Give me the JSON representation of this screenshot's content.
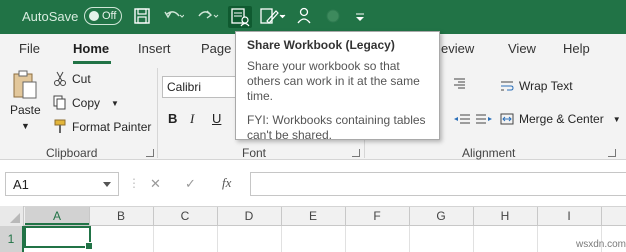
{
  "qat": {
    "autosave_label": "AutoSave",
    "autosave_state": "Off"
  },
  "tabs": [
    "File",
    "Home",
    "Insert",
    "Page",
    "eview",
    "View",
    "Help"
  ],
  "clipboard": {
    "paste": "Paste",
    "cut": "Cut",
    "copy": "Copy",
    "format_painter": "Format Painter",
    "group_label": "Clipboard"
  },
  "font": {
    "font_name": "Calibri",
    "bold": "B",
    "italic": "I",
    "group_label": "Font"
  },
  "alignment": {
    "wrap_text": "Wrap Text",
    "merge_center": "Merge & Center",
    "group_label": "Alignment"
  },
  "formula_bar": {
    "name_box": "A1",
    "cancel_symbol": "✕",
    "enter_symbol": "✓",
    "fx_symbol": "fx"
  },
  "grid": {
    "columns": [
      "A",
      "B",
      "C",
      "D",
      "E",
      "F",
      "G",
      "H",
      "I"
    ],
    "rows": [
      "1"
    ]
  },
  "tooltip": {
    "title": "Share Workbook (Legacy)",
    "description": "Share your workbook so that others can work in it at the same time.",
    "note": "FYI: Workbooks containing tables can't be shared."
  },
  "watermark": "wsxdn.com",
  "colors": {
    "excel_green": "#217346",
    "ribbon_bg": "#f3f3f3"
  }
}
